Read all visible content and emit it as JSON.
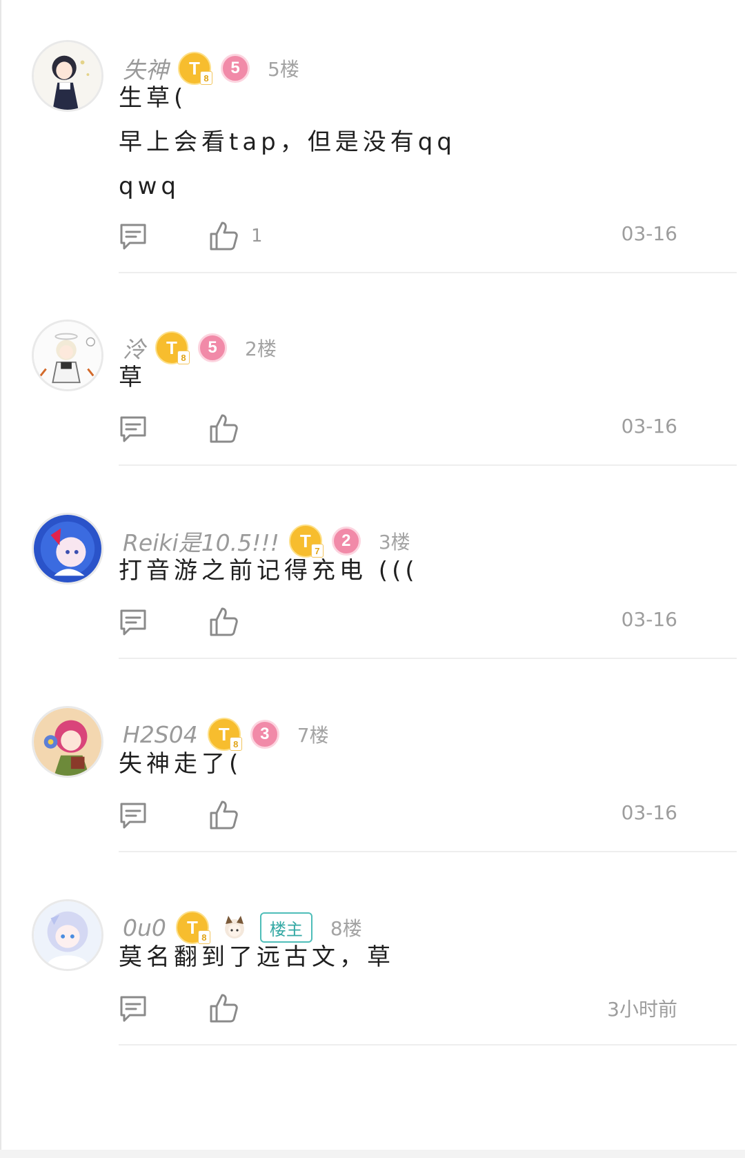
{
  "comments": [
    {
      "username": "失神",
      "badge_t": "T",
      "badge_t_sub": "8",
      "level": "5",
      "floor": "5楼",
      "lines": [
        "生草(",
        "早上会看tap，但是没有qq",
        "qwq"
      ],
      "like_count": "1",
      "time": "03-16"
    },
    {
      "username": "泠",
      "badge_t": "T",
      "badge_t_sub": "8",
      "level": "5",
      "floor": "2楼",
      "lines": [
        "草"
      ],
      "like_count": "",
      "time": "03-16"
    },
    {
      "username": "Reiki是10.5!!!",
      "badge_t": "T",
      "badge_t_sub": "7",
      "level": "2",
      "floor": "3楼",
      "lines": [
        "打音游之前记得充电 ((("
      ],
      "like_count": "",
      "time": "03-16"
    },
    {
      "username": "H2S04",
      "badge_t": "T",
      "badge_t_sub": "8",
      "level": "3",
      "floor": "7楼",
      "lines": [
        "失神走了("
      ],
      "like_count": "",
      "time": "03-16"
    },
    {
      "username": "0u0",
      "badge_t": "T",
      "badge_t_sub": "8",
      "owner_badge": "楼主",
      "floor": "8楼",
      "lines": [
        "莫名翻到了远古文，草"
      ],
      "like_count": "",
      "time": "3小时前"
    }
  ],
  "colors": {
    "badge_gold": "#f7bd2e",
    "badge_pink": "#f18aa8",
    "owner_teal": "#4dbdb8"
  },
  "icons": {
    "reply": "comment-icon",
    "like": "thumbs-up-icon"
  }
}
